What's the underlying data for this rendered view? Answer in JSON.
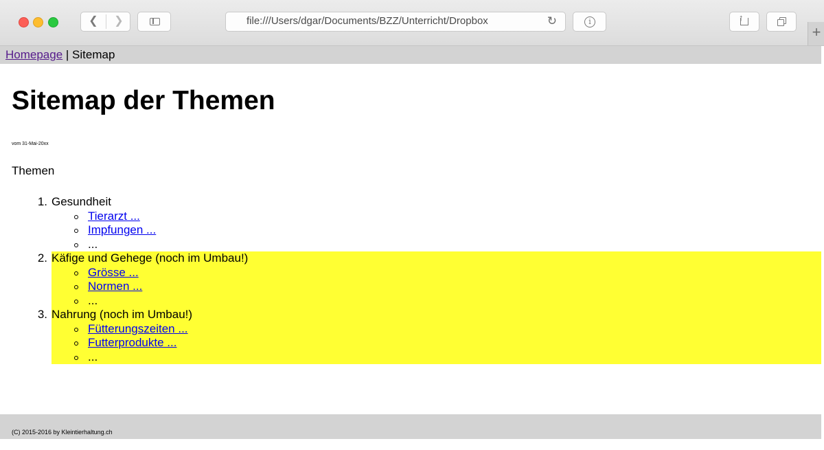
{
  "browser": {
    "address_url": "file:///Users/dgar/Documents/BZZ/Unterricht/Dropbox",
    "new_tab_label": "+",
    "icons": {
      "back": "chevron-left-icon",
      "forward": "chevron-right-icon",
      "sidebar": "sidebar-icon",
      "reload": "reload-icon",
      "info": "info-icon",
      "share": "share-icon",
      "tabs": "tabs-overview-icon"
    }
  },
  "nav": {
    "home_link": "Homepage",
    "separator": " | ",
    "current": "Sitemap"
  },
  "header": {
    "title": "Sitemap der Themen",
    "date": "vom 31-Mai-20xx"
  },
  "section_label": "Themen",
  "topics": [
    {
      "number": "1.",
      "title": "Gesundheit",
      "highlighted": false,
      "items": [
        {
          "label": "Tierarzt ...",
          "link": true
        },
        {
          "label": "Impfungen ...",
          "link": true
        },
        {
          "label": "...",
          "link": false
        }
      ]
    },
    {
      "number": "2.",
      "title": "Käfige und Gehege (noch im Umbau!)",
      "highlighted": true,
      "items": [
        {
          "label": "Grösse ...",
          "link": true
        },
        {
          "label": "Normen ...",
          "link": true
        },
        {
          "label": "...",
          "link": false
        }
      ]
    },
    {
      "number": "3.",
      "title": "Nahrung (noch im Umbau!)",
      "highlighted": true,
      "items": [
        {
          "label": "Fütterungszeiten ...",
          "link": true
        },
        {
          "label": "Futterprodukte ...",
          "link": true
        },
        {
          "label": "...",
          "link": false
        }
      ]
    }
  ],
  "footer": {
    "text": "(C) 2015-2016 by Kleintierhaltung.ch"
  },
  "colors": {
    "highlight": "#ffff33",
    "link": "#0000ee",
    "visited_link": "#551a8b",
    "bar_gray": "#d3d3d3"
  }
}
